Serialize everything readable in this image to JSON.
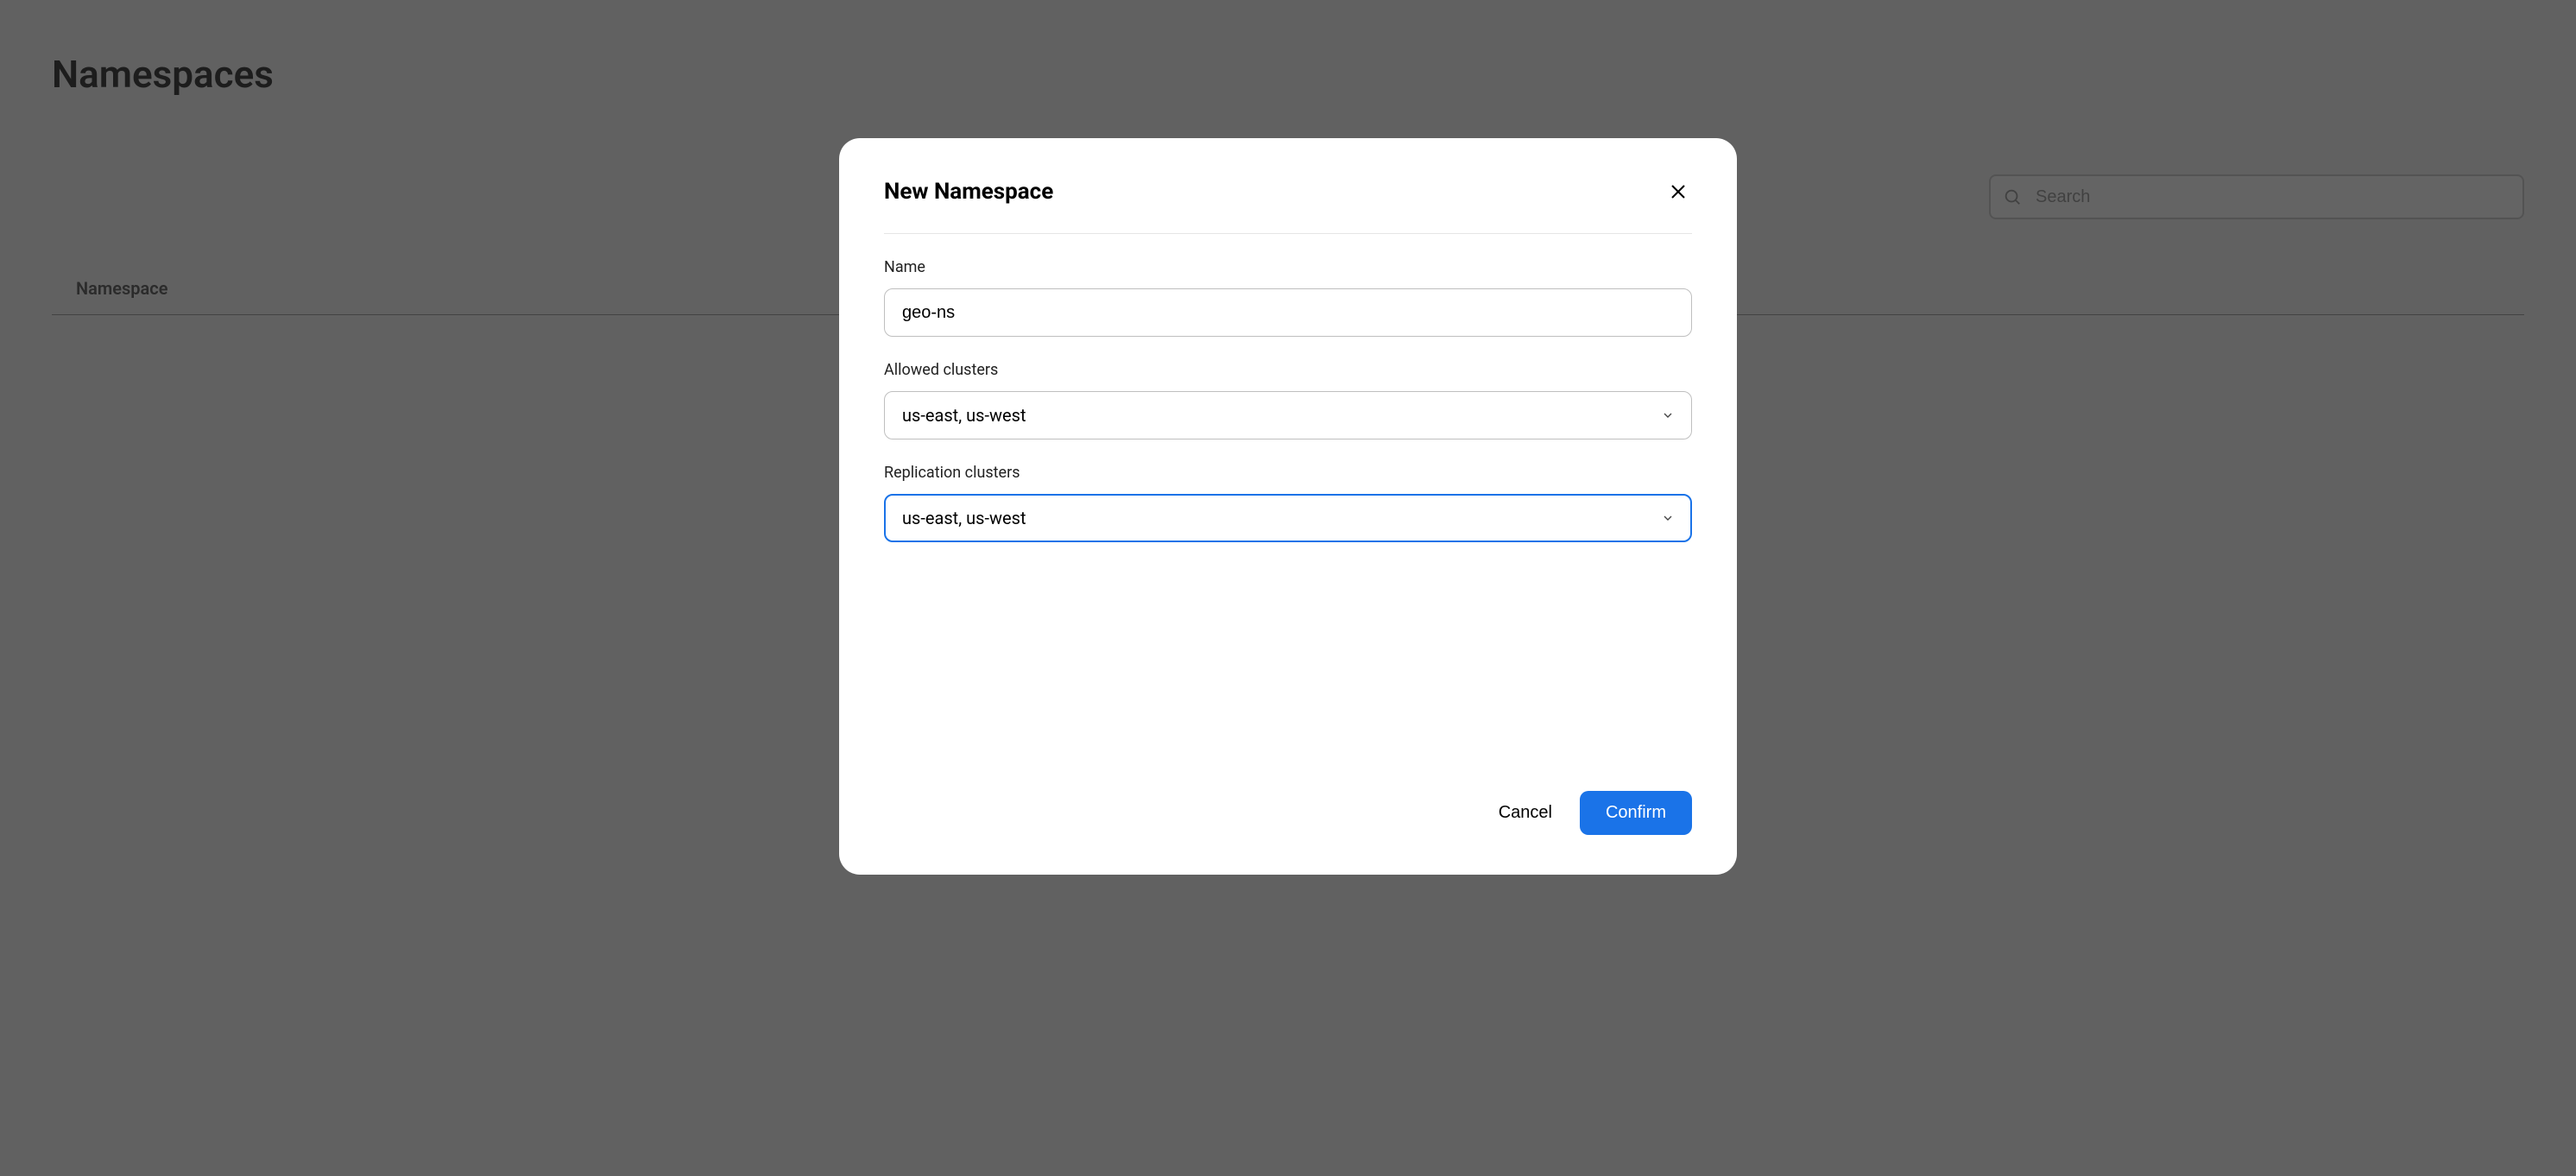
{
  "page": {
    "title": "Namespaces",
    "search_placeholder": "Search",
    "table": {
      "columns": [
        "Namespace"
      ]
    }
  },
  "modal": {
    "title": "New Namespace",
    "name": {
      "label": "Name",
      "value": "geo-ns"
    },
    "allowed_clusters": {
      "label": "Allowed clusters",
      "value": "us-east, us-west"
    },
    "replication_clusters": {
      "label": "Replication clusters",
      "value": "us-east, us-west"
    },
    "cancel_label": "Cancel",
    "confirm_label": "Confirm"
  }
}
